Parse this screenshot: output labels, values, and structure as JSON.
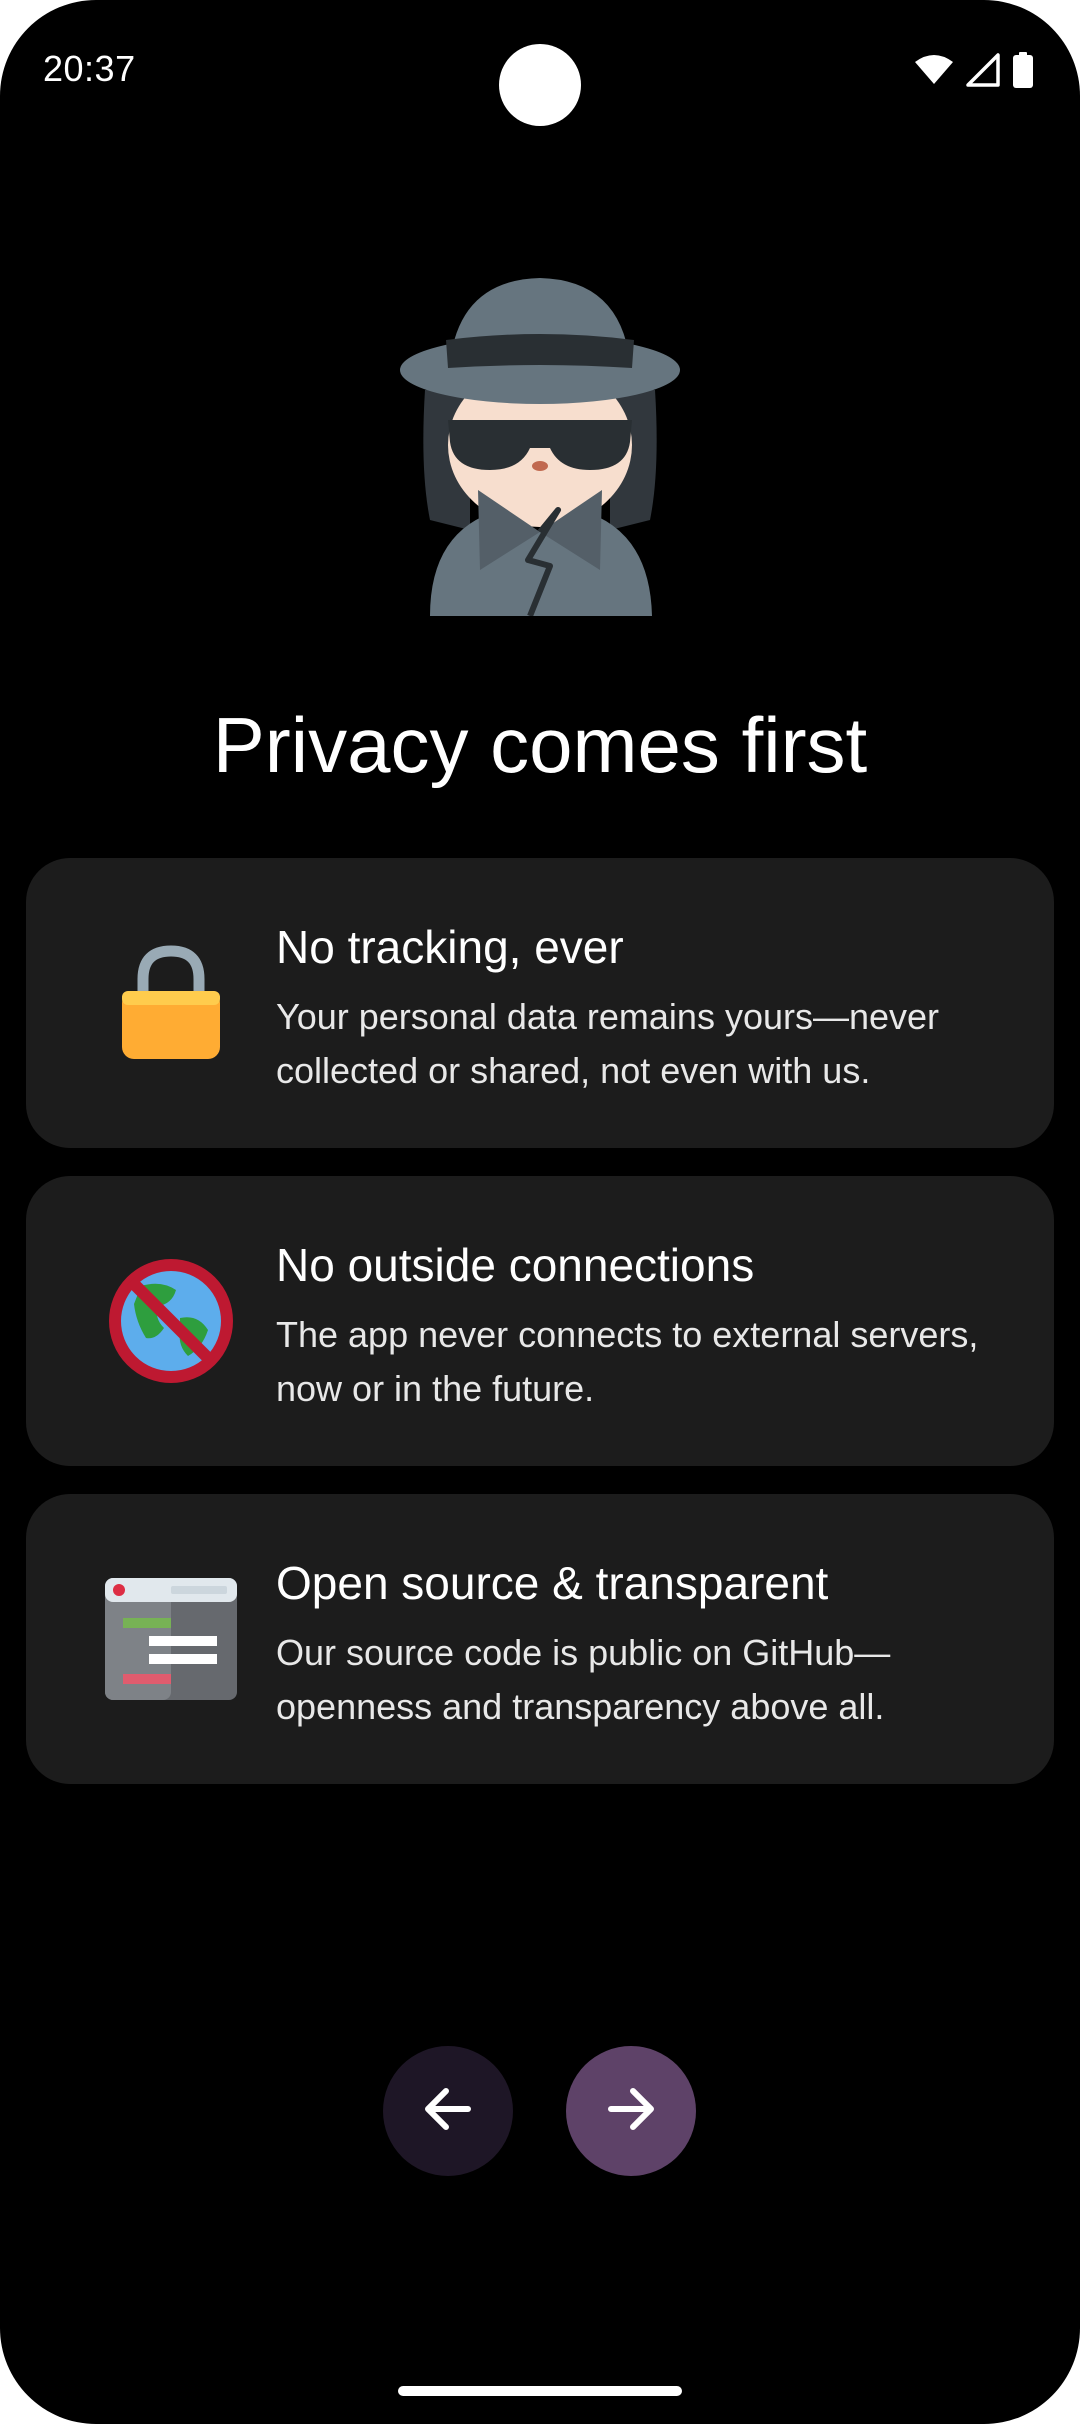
{
  "status_bar": {
    "time": "20:37",
    "icons": [
      "wifi-icon",
      "cell-signal-icon",
      "battery-icon"
    ]
  },
  "hero": {
    "icon": "detective-icon"
  },
  "title": "Privacy comes first",
  "cards": [
    {
      "icon": "lock-icon",
      "title": "No tracking, ever",
      "description": "Your personal data remains yours—never collected or shared, not even with us."
    },
    {
      "icon": "no-globe-icon",
      "title": "No outside connections",
      "description": "The app never connects to external servers, now or in the future."
    },
    {
      "icon": "source-code-window-icon",
      "title": "Open source & transparent",
      "description": "Our source code is public on GitHub—openness and transparency above all."
    }
  ],
  "navigation": {
    "back_icon": "arrow-left-icon",
    "next_icon": "arrow-right-icon"
  },
  "colors": {
    "background": "#000000",
    "card": "#1c1c1c",
    "back_button": "#1e1626",
    "next_button": "#5e4268",
    "lock": "#fbb03b"
  }
}
